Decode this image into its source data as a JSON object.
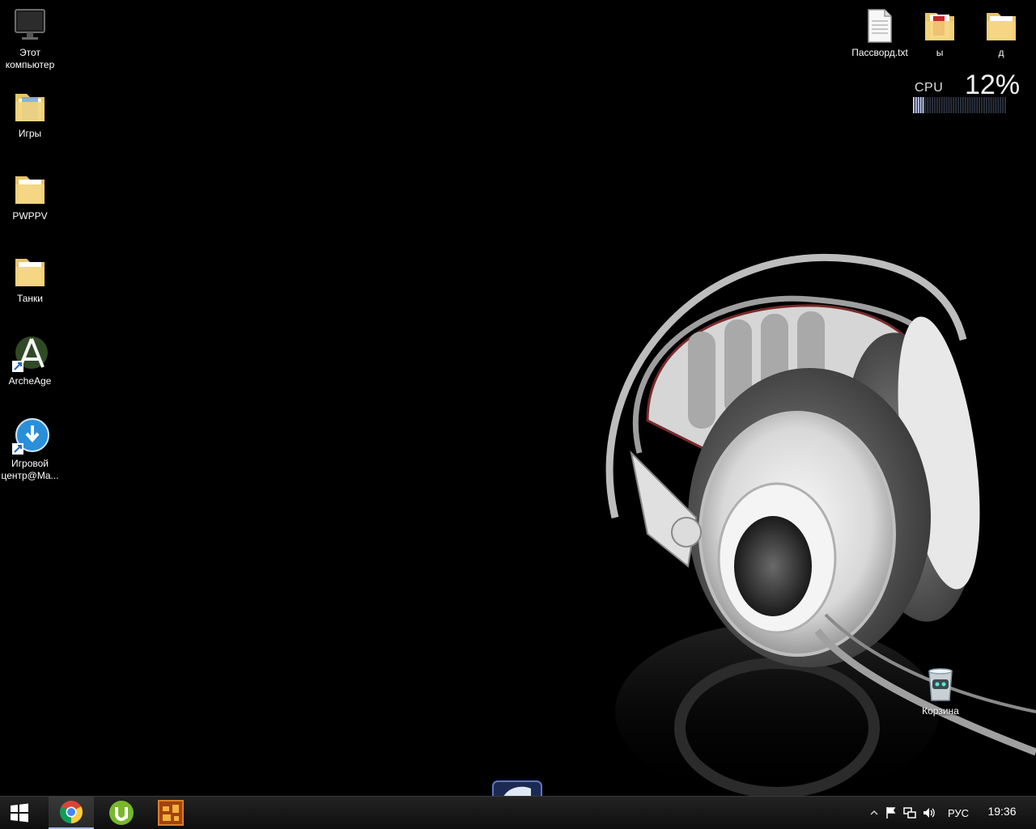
{
  "desktop": {
    "left_icons": [
      {
        "label": "Этот компьютер",
        "icon": "monitor-icon"
      },
      {
        "label": "Игры",
        "icon": "folder-icon"
      },
      {
        "label": "PWPPV",
        "icon": "folder-icon"
      },
      {
        "label": "Танки",
        "icon": "folder-icon"
      },
      {
        "label": "ArcheAge",
        "icon": "archeage-shortcut-icon"
      },
      {
        "label": "Игровой центр@Ma...",
        "icon": "game-center-shortcut-icon"
      }
    ],
    "top_right_icons": [
      {
        "label": "Пассворд.txt",
        "icon": "text-file-icon"
      },
      {
        "label": "ы",
        "icon": "folder-icon"
      },
      {
        "label": "д",
        "icon": "folder-icon"
      }
    ],
    "recycle_bin": {
      "label": "Корзина",
      "icon": "recycle-bin-icon"
    }
  },
  "cpu_gadget": {
    "label": "CPU",
    "value_text": "12%",
    "usage_percent": 12
  },
  "taskbar": {
    "start_icon": "windows-start-icon",
    "pinned": [
      {
        "name": "chrome",
        "icon": "chrome-icon",
        "active": true
      },
      {
        "name": "utorrent",
        "icon": "utorrent-icon",
        "active": false
      },
      {
        "name": "game",
        "icon": "game-app-icon",
        "active": false
      }
    ],
    "tray": {
      "language": "РУС",
      "time": "19:36",
      "icons": [
        "show-hidden-icons-chevron",
        "action-center-flag-icon",
        "network-icon",
        "volume-icon"
      ]
    }
  },
  "colors": {
    "background": "#000000",
    "folder": "#f3d37a",
    "taskbar": "#1a1a1a"
  }
}
